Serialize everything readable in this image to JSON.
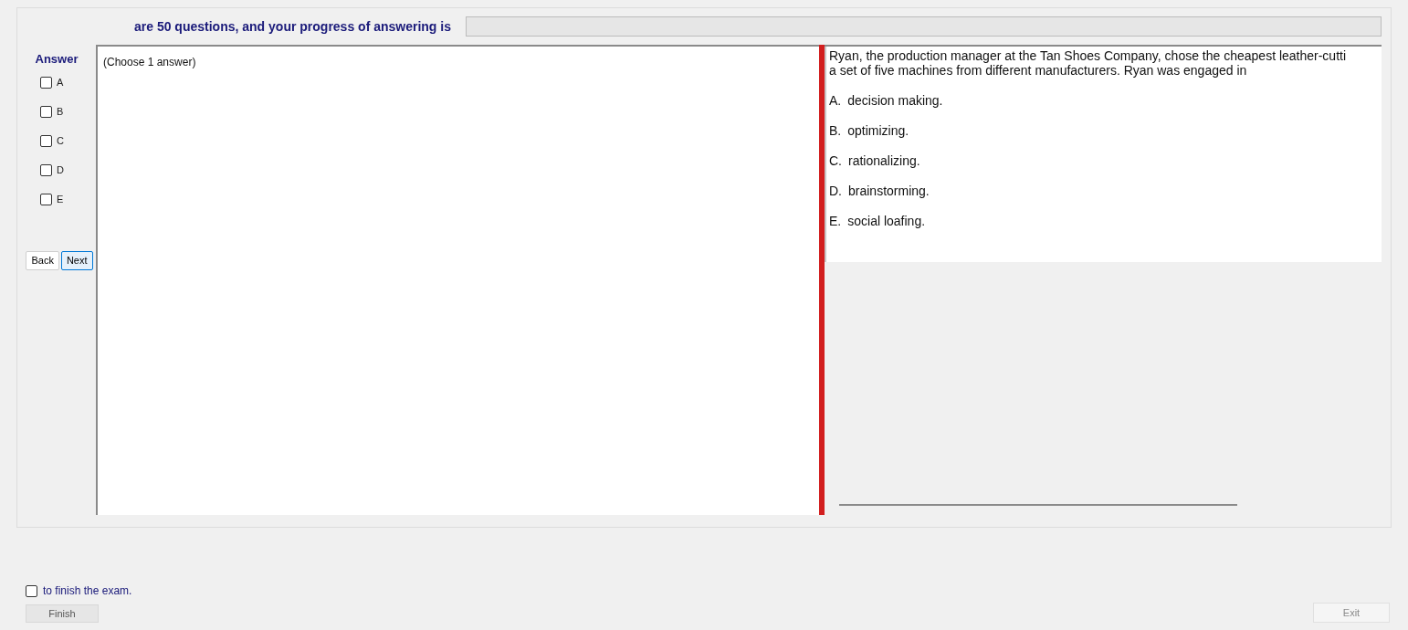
{
  "header": {
    "text": "are 50 questions, and your progress of answering is",
    "progress": {
      "level": 0
    }
  },
  "answer_panel": {
    "title": "Answer",
    "options": [
      {
        "label": "A",
        "checked": false
      },
      {
        "label": "B",
        "checked": false
      },
      {
        "label": "C",
        "checked": false
      },
      {
        "label": "D",
        "checked": false
      },
      {
        "label": "E",
        "checked": false
      }
    ],
    "buttons": [
      {
        "label": "Back",
        "selected": false
      },
      {
        "label": "Next",
        "selected": true
      }
    ]
  },
  "answer_box": {
    "hint": "(Choose 1 answer)"
  },
  "question": {
    "text": [
      "Ryan, the production manager at the Tan Shoes Company, chose the cheapest leather-cutti",
      "a set of five machines from different manufacturers. Ryan was engaged in"
    ],
    "choices": [
      {
        "letter": "A.",
        "text": "decision making."
      },
      {
        "letter": "B.",
        "text": "optimizing."
      },
      {
        "letter": "C.",
        "text": "rationalizing."
      },
      {
        "letter": "D.",
        "text": "brainstorming."
      },
      {
        "letter": "E.",
        "text": "social loafing."
      }
    ]
  },
  "footer": {
    "finish_check": {
      "label": "to finish the exam.",
      "checked": false
    },
    "finish_button": "Finish",
    "exit_button": "Exit"
  }
}
